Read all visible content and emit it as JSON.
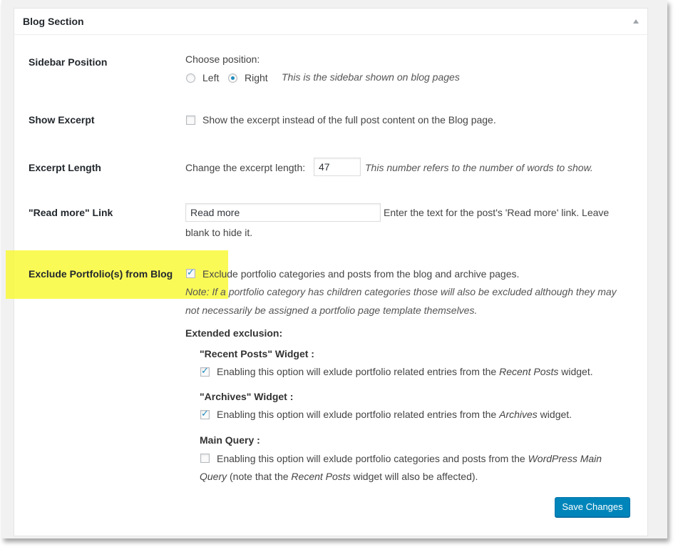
{
  "box": {
    "title": "Blog Section"
  },
  "sidebar_position": {
    "label": "Sidebar Position",
    "choose": "Choose position:",
    "options": [
      {
        "label": "Left",
        "checked": false
      },
      {
        "label": "Right",
        "checked": true
      }
    ],
    "hint": "This is the sidebar shown on blog pages"
  },
  "show_excerpt": {
    "label": "Show Excerpt",
    "checked": false,
    "text": "Show the excerpt instead of the full post content on the Blog page."
  },
  "excerpt_length": {
    "label": "Excerpt Length",
    "prefix": "Change the excerpt length:",
    "value": "47",
    "hint": "This number refers to the number of words to show."
  },
  "read_more": {
    "label": "\"Read more\" Link",
    "value": "Read more",
    "text_line1": "Enter the text for the post's 'Read more' link. Leave",
    "text_line2": "blank to hide it."
  },
  "exclude_portfolio": {
    "label": "Exclude Portfolio(s) from Blog",
    "checked": true,
    "text": "Exclude portfolio categories and posts from the blog and archive pages.",
    "note_line1": "Note: If a portfolio category has children categories those will also be excluded although they may",
    "note_line2": "not necessarily be assigned a portfolio page template themselves.",
    "extended_label": "Extended exclusion:",
    "recent_posts": {
      "heading": "\"Recent Posts\" Widget :",
      "checked": true,
      "text_before": "Enabling this option will exlude portfolio related entries from the ",
      "text_em": "Recent Posts",
      "text_after": " widget."
    },
    "archives": {
      "heading": "\"Archives\" Widget :",
      "checked": true,
      "text_before": "Enabling this option will exlude portfolio related entries from the ",
      "text_em": "Archives",
      "text_after": " widget."
    },
    "main_query": {
      "heading": "Main Query :",
      "checked": false,
      "text_before": "Enabling this option will exlude portfolio categories and posts from the ",
      "text_em": "WordPress Main",
      "line2_em": "Query",
      "line2_mid": " (note that the ",
      "line2_em2": "Recent Posts",
      "line2_after": " widget will also be affected)."
    }
  },
  "save_button": "Save Changes",
  "colors": {
    "highlight": "#f9f93a",
    "primary_button": "#0085ba",
    "check": "#1e8cbe"
  }
}
